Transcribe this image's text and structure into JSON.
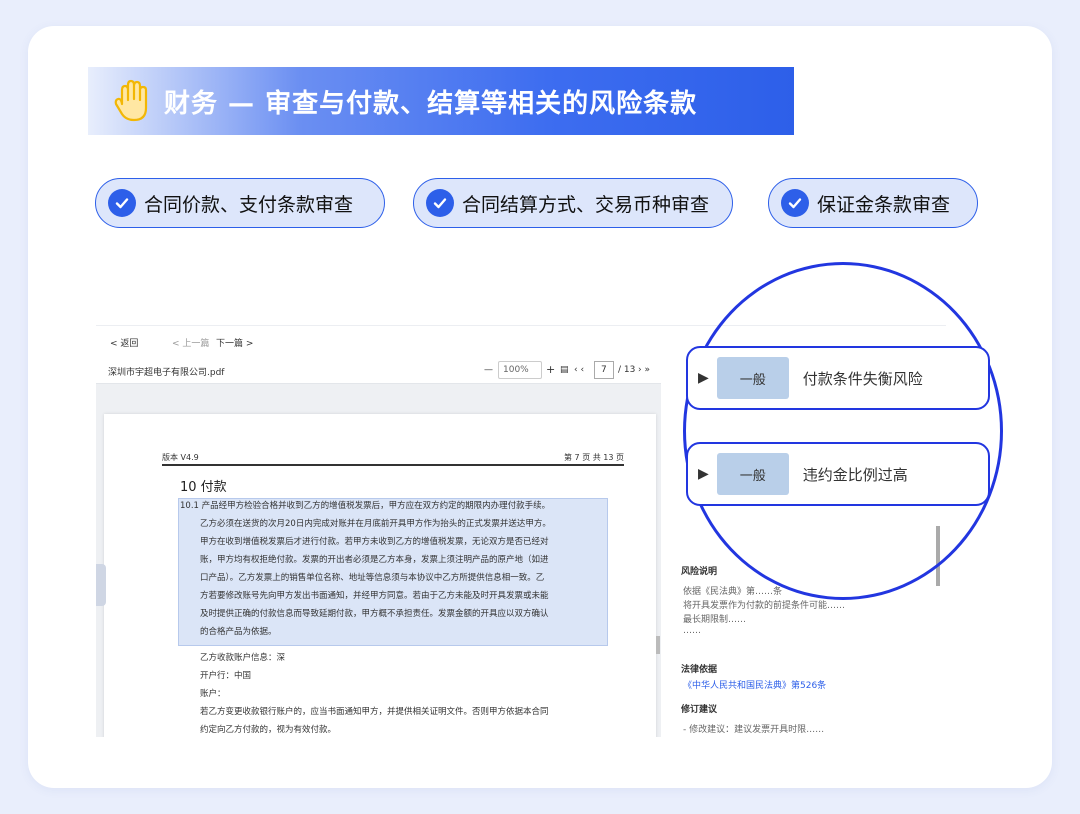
{
  "title": "财务 — 审查与付款、结算等相关的风险条款",
  "pills": [
    {
      "label": "合同价款、支付条款审查"
    },
    {
      "label": "合同结算方式、交易币种审查"
    },
    {
      "label": "保证金条款审查"
    }
  ],
  "viewer": {
    "back": "< 返回",
    "prev": "< 上一篇",
    "next": "下一篇 >",
    "file_name": "深圳市宇超电子有限公司.pdf",
    "zoom": "100%",
    "page_input": "7",
    "page_total": "/ 13",
    "doc_version": "版本 V4.9",
    "doc_pageinfo": "第 7 页   共 13 页",
    "section_title": "10 付款",
    "paragraph_lines": [
      "10.1 产品经甲方检验合格并收到乙方的增值税发票后，甲方应在双方约定的期限内办理付款手续。",
      "乙方必须在送货的次月20日内完成对账并在月底前开具甲方作为抬头的正式发票并送达甲方。",
      "甲方在收到增值税发票后才进行付款。若甲方未收到乙方的增值税发票，无论双方是否已经对",
      "账，甲方均有权拒绝付款。发票的开出者必须是乙方本身，发票上须注明产品的原产地（如进",
      "口产品）。乙方发票上的销售单位名称、地址等信息须与本协议中乙方所提供信息相一致。乙",
      "方若要修改账号先向甲方发出书面通知，并经甲方同意。若由于乙方未能及时开具发票或未能",
      "及时提供正确的付款信息而导致延期付款，甲方概不承担责任。发票金额的开具应以双方确认",
      "的合格产品为依据。"
    ],
    "account_lines": [
      "乙方收款账户信息：深",
      "开户行：中国",
      "账户：",
      "若乙方变更收款银行账户的，应当书面通知甲方，并提供相关证明文件。否则甲方依据本合同",
      "约定向乙方付款的，视为有效付款。"
    ]
  },
  "risk_panel": {
    "risks": [
      {
        "level": "一般",
        "label": "付款条件失衡风险"
      },
      {
        "level": "一般",
        "label": "违约金比例过高"
      }
    ],
    "explain_heading": "风险说明",
    "explain_lines": [
      "依据《民法典》第……条",
      "将开具发票作为付款的前提条件可能……",
      "最长期限制……",
      "……"
    ],
    "law_heading": "法律依据",
    "law_link": "《中华人民共和国民法典》第526条",
    "advice_heading": "修订建议",
    "advice_line": "- 修改建议：建议发票开具时限……"
  }
}
